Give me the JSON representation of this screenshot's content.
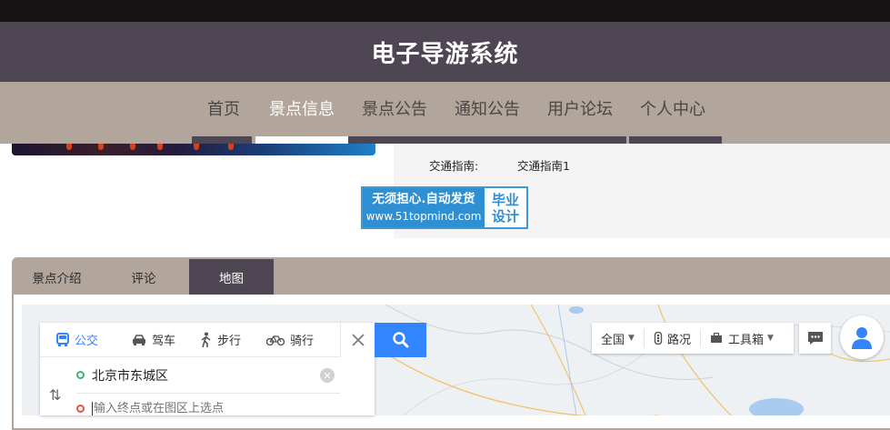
{
  "site": {
    "title": "电子导游系统"
  },
  "nav": {
    "items": [
      {
        "label": "首页",
        "active": false
      },
      {
        "label": "景点信息",
        "active": true
      },
      {
        "label": "景点公告",
        "active": false
      },
      {
        "label": "通知公告",
        "active": false
      },
      {
        "label": "用户论坛",
        "active": false
      },
      {
        "label": "个人中心",
        "active": false
      }
    ]
  },
  "info": {
    "traffic_label": "交通指南:",
    "traffic_value": "交通指南1"
  },
  "ad": {
    "line1": "无须担心.自动发货",
    "line2": "www.51topmind.com",
    "side1": "毕业",
    "side2": "设计"
  },
  "tabs": [
    {
      "label": "景点介绍",
      "active": false
    },
    {
      "label": "评论",
      "active": false
    },
    {
      "label": "地图",
      "active": true
    }
  ],
  "map": {
    "modes": [
      {
        "label": "公交",
        "icon": "bus-icon",
        "active": true
      },
      {
        "label": "驾车",
        "icon": "car-icon",
        "active": false
      },
      {
        "label": "步行",
        "icon": "walk-icon",
        "active": false
      },
      {
        "label": "骑行",
        "icon": "bike-icon",
        "active": false
      }
    ],
    "start": "北京市东城区",
    "end_placeholder": "输入终点或在图区上选点",
    "tools": {
      "region": "全国",
      "traffic": "路况",
      "toolbox": "工具箱"
    }
  },
  "colors": {
    "header": "#4e4753",
    "nav": "#b2a59b",
    "accent": "#3385ff"
  }
}
